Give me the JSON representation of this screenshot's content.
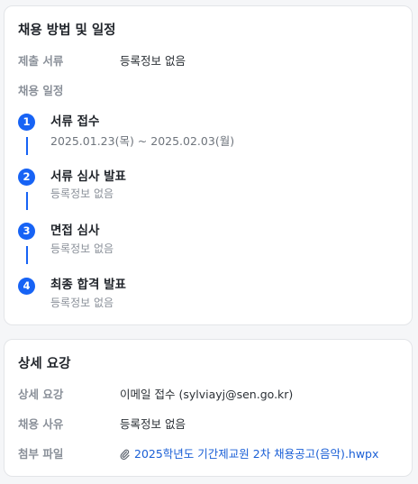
{
  "schedule_section": {
    "title": "채용 방법 및 일정",
    "documents_label": "제출 서류",
    "documents_value": "등록정보 없음",
    "schedule_label": "채용 일정",
    "steps": [
      {
        "number": "1",
        "title": "서류 접수",
        "detail": "2025.01.23(목) ~ 2025.02.03(월)"
      },
      {
        "number": "2",
        "title": "서류 심사 발표",
        "detail": "등록정보 없음"
      },
      {
        "number": "3",
        "title": "면접 심사",
        "detail": "등록정보 없음"
      },
      {
        "number": "4",
        "title": "최종 합격 발표",
        "detail": "등록정보 없음"
      }
    ]
  },
  "details_section": {
    "title": "상세 요강",
    "rows": [
      {
        "label": "상세 요강",
        "value": "이메일 접수 (sylviayj@sen.go.kr)"
      },
      {
        "label": "채용 사유",
        "value": "등록정보 없음"
      },
      {
        "label": "첨부 파일",
        "value": "2025학년도 기간제교원 2차 채용공고(음악).hwpx",
        "icon": "paperclip-icon"
      }
    ]
  },
  "colors": {
    "accent": "#1763f5",
    "link": "#1a5fd6",
    "muted": "#8a9099"
  }
}
